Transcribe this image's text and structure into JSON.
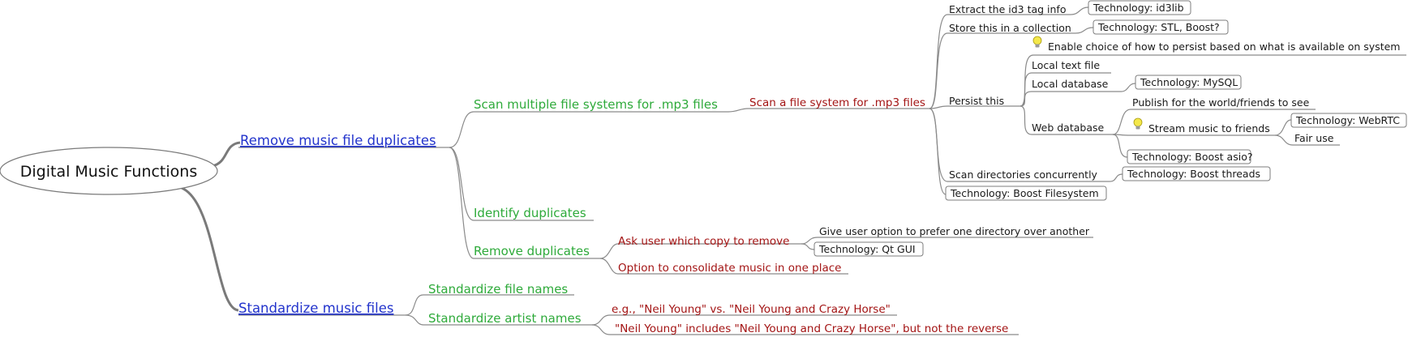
{
  "root": {
    "label": "Digital Music Functions"
  },
  "branches": {
    "remove_duplicates": {
      "label": "Remove music file duplicates",
      "scan_multiple": "Scan multiple file systems for .mp3 files",
      "scan_single": "Scan a file system for .mp3 files",
      "extract_id3": "Extract the id3 tag info",
      "tech_id3lib": "Technology: id3lib",
      "store_collection": "Store this in a collection",
      "tech_stl_boost": "Technology: STL, Boost?",
      "persist_this": "Persist this",
      "persist_choice": "Enable choice of how to persist based on what is available on system",
      "local_text_file": "Local text file",
      "local_database": "Local database",
      "tech_mysql": "Technology: MySQL",
      "web_database": "Web database",
      "publish_world": "Publish for the world/friends to see",
      "stream_friends": "Stream music to friends",
      "tech_webrtc": "Technology: WebRTC",
      "fair_use": "Fair use",
      "tech_boost_asio": "Technology: Boost asio?",
      "scan_concurrently": "Scan directories concurrently",
      "tech_boost_threads": "Technology: Boost threads",
      "tech_boost_filesystem": "Technology: Boost Filesystem",
      "identify_duplicates": "Identify duplicates",
      "remove_duplicates_child": "Remove duplicates",
      "ask_user": "Ask user which copy to remove",
      "give_option": "Give user option to prefer one directory over another",
      "tech_qt_gui": "Technology: Qt GUI",
      "consolidate": "Option to consolidate music in one place"
    },
    "standardize": {
      "label": "Standardize music files",
      "file_names": "Standardize file names",
      "artist_names": "Standardize artist names",
      "example_eg": "e.g., \"Neil Young\" vs. \"Neil Young and Crazy Horse\"",
      "example_includes": "\"Neil Young\" includes \"Neil Young and Crazy Horse\", but not the reverse"
    }
  }
}
